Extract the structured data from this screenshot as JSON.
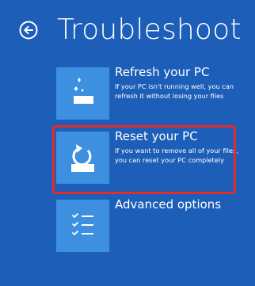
{
  "header": {
    "title": "Troubleshoot",
    "back_icon": "back-arrow-icon"
  },
  "options": [
    {
      "label": "Refresh your PC",
      "description": "If your PC isn't running well, you can refresh it without losing your files",
      "icon": "refresh-pc-icon"
    },
    {
      "label": "Reset your PC",
      "description": "If you want to remove all of your files, you can reset your PC completely",
      "icon": "reset-pc-icon",
      "highlighted": true
    },
    {
      "label": "Advanced options",
      "description": "",
      "icon": "checklist-icon"
    }
  ],
  "colors": {
    "background": "#1d5fb8",
    "tile": "#3d8fdf",
    "highlight": "#e42b2b"
  }
}
